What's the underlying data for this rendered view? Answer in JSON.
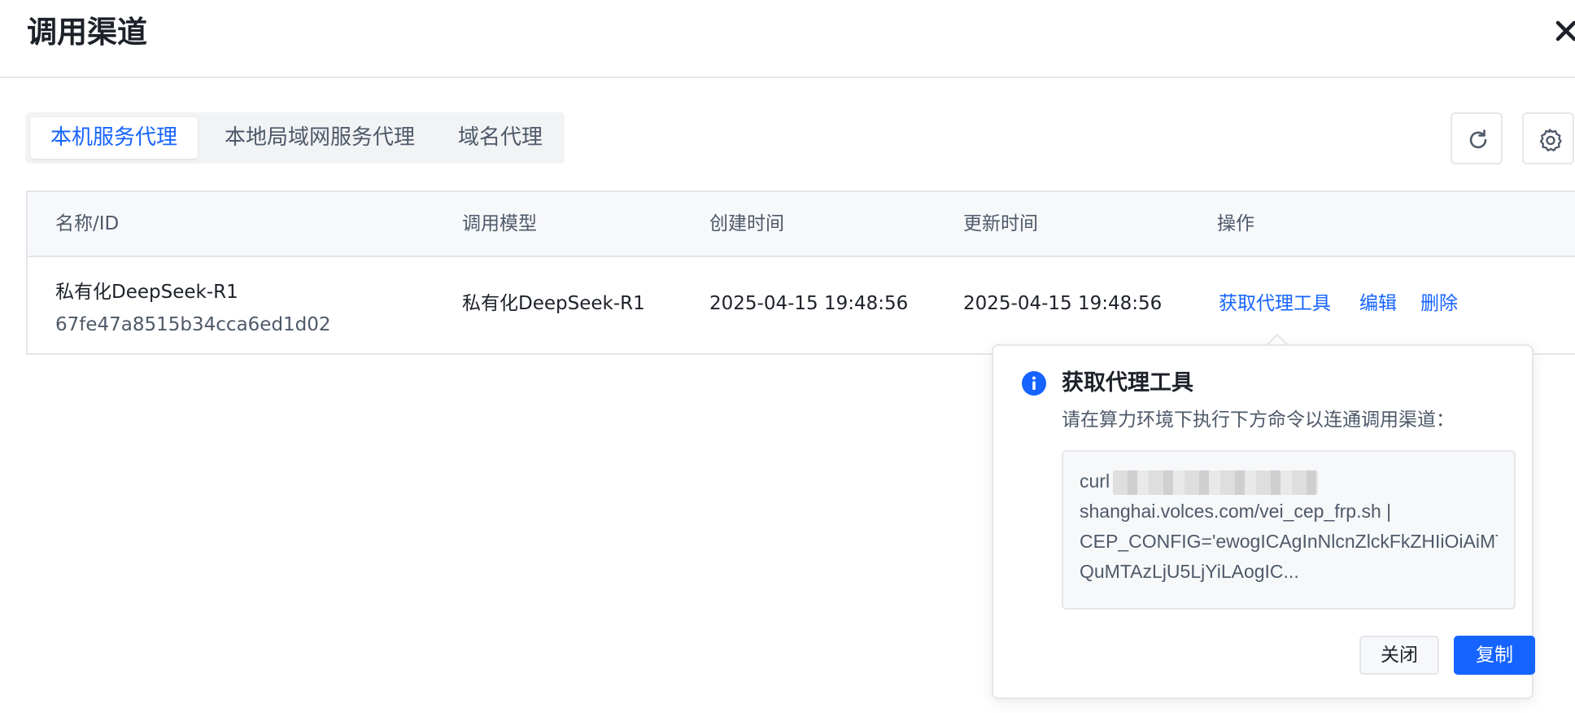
{
  "dialog": {
    "title": "调用渠道",
    "close_icon": "close-icon"
  },
  "tabs": [
    {
      "label": "本机服务代理",
      "active": true
    },
    {
      "label": "本地局域网服务代理",
      "active": false
    },
    {
      "label": "域名代理",
      "active": false
    }
  ],
  "toolbar": {
    "refresh_icon": "refresh-icon",
    "settings_icon": "gear-icon"
  },
  "table": {
    "columns": [
      "名称/ID",
      "调用模型",
      "创建时间",
      "更新时间",
      "操作"
    ],
    "rows": [
      {
        "name": "私有化DeepSeek-R1",
        "id": "67fe47a8515b34cca6ed1d02",
        "model": "私有化DeepSeek-R1",
        "created": "2025-04-15 19:48:56",
        "updated": "2025-04-15 19:48:56",
        "actions": [
          "获取代理工具",
          "编辑",
          "删除"
        ]
      }
    ]
  },
  "popover": {
    "title": "获取代理工具",
    "description": "请在算力环境下执行下方命令以连通调用渠道：",
    "command_lines": [
      "curl",
      "shanghai.volces.com/vei_cep_frp.sh |",
      "CEP_CONFIG='ewogICAgInNlcnZlckFkZHIiOiAiMT",
      "QuMTAzLjU5LjYiLAogIC..."
    ],
    "cancel_label": "关闭",
    "copy_label": "复制"
  },
  "colors": {
    "primary": "#1664ff",
    "border": "#e5e6eb",
    "header_bg": "#f7f8fa"
  }
}
